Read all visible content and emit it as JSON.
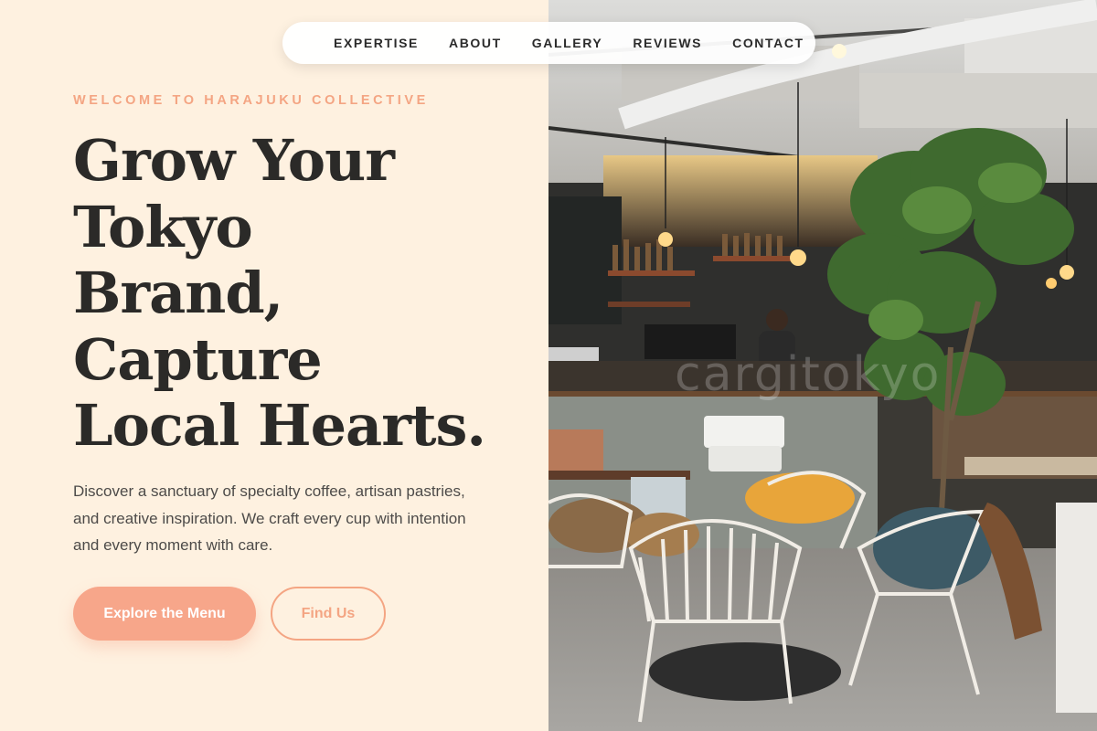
{
  "nav": {
    "items": [
      {
        "label": "EXPERTISE"
      },
      {
        "label": "ABOUT"
      },
      {
        "label": "GALLERY"
      },
      {
        "label": "REVIEWS"
      },
      {
        "label": "CONTACT"
      }
    ]
  },
  "hero": {
    "eyebrow": "WELCOME TO HARAJUKU COLLECTIVE",
    "headline_lines": [
      "Grow Your",
      "Tokyo",
      "Brand,",
      "Capture",
      "Local Hearts."
    ],
    "description": "Discover a sanctuary of specialty coffee, artisan pastries, and creative inspiration. We craft every cup with intention and every moment with care.",
    "primary_button": "Explore the Menu",
    "secondary_button": "Find Us"
  },
  "photo": {
    "subject": "cafe interior photo",
    "watermark": "cargitokyo"
  },
  "colors": {
    "background": "#fef1e0",
    "accent": "#f7a68a",
    "text_dark": "#2b2a28"
  }
}
